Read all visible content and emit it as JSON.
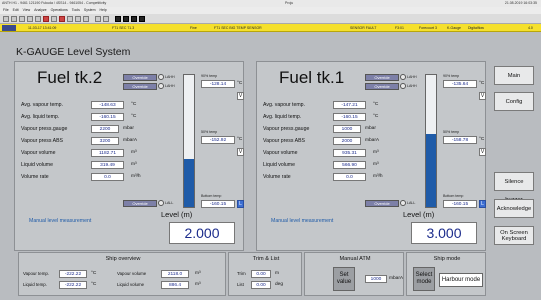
{
  "window": {
    "title": "ANTH H1 - 9461 121190 Fukuda / 4SS14 - 9461054 - Competitivity",
    "center_title": "Proju",
    "right_info": "21.08.2019 16:03:35"
  },
  "menu": [
    "File",
    "Edit",
    "View",
    "Analyze",
    "Operations",
    "Tools",
    "System",
    "Help"
  ],
  "alarm_bar": {
    "items": [
      "11-03-17 13:41:09",
      "FT1 SEC 71.3",
      "Fine",
      "FT1 SEC BIG TEMP SENSOR",
      "SENSOR FAULT",
      "F3:01",
      "Forecourt 3",
      "K-Gauge",
      "Digitalflow",
      "4.0"
    ]
  },
  "page": {
    "title": "K-GAUGE Level System"
  },
  "labels": {
    "avg_vapour": "Avg. vapour temp.",
    "avg_liquid": "Avg. liquid temp.",
    "vap_press_gauge": "Vapour press.gauge",
    "vap_press_abs": "Vapour press ABS",
    "vap_volume": "Vapour volume",
    "liq_volume": "Liquid volume",
    "vol_rate": "Volume rate",
    "override": "Override",
    "lahh": "LAHH",
    "lahi": "LAHH",
    "lall": "LALL",
    "manual": "Manual level measurement",
    "level": "Level (m)",
    "top_temp": "90% temp",
    "mid_temp": "50% temp",
    "bottom_temp": "Bottom temp"
  },
  "tank2": {
    "name": "Fuel tk.2",
    "avg_vapour": "-148.63",
    "avg_vapour_unit": "°C",
    "avg_liquid": "-160.15",
    "avg_liquid_unit": "°C",
    "vap_press_gauge": "2200",
    "vap_press_gauge_unit": "mbar",
    "vap_press_abs": "3200",
    "vap_press_abs_unit": "mbarA",
    "vap_volume": "1182.71",
    "vap_volume_unit": "m³",
    "liq_volume": "319.49",
    "liq_volume_unit": "m³",
    "vol_rate": "0.0",
    "vol_rate_unit": "m³/h",
    "top_temp": "-128.14",
    "top_temp_unit": "°C",
    "top_flag": "V",
    "mid_temp": "-152.92",
    "mid_temp_unit": "°C",
    "mid_flag": "V",
    "bottom_temp": "-160.15",
    "bottom_temp_unit": "°C",
    "bottom_flag": "L",
    "level": "2.000",
    "fill_fraction": 0.36
  },
  "tank1": {
    "name": "Fuel tk.1",
    "avg_vapour": "-147.21",
    "avg_vapour_unit": "°C",
    "avg_liquid": "-160.15",
    "avg_liquid_unit": "°C",
    "vap_press_gauge": "1000",
    "vap_press_gauge_unit": "mbar",
    "vap_press_abs": "2000",
    "vap_press_abs_unit": "mbarA",
    "vap_volume": "935.31",
    "vap_volume_unit": "m³",
    "liq_volume": "566.90",
    "liq_volume_unit": "m³",
    "vol_rate": "0.0",
    "vol_rate_unit": "m³/h",
    "top_temp": "-135.64",
    "top_temp_unit": "°C",
    "top_flag": "V",
    "mid_temp": "-158.78",
    "mid_temp_unit": "°C",
    "mid_flag": "V",
    "bottom_temp": "-160.15",
    "bottom_temp_unit": "°C",
    "bottom_flag": "L",
    "level": "3.000",
    "fill_fraction": 0.55
  },
  "side_buttons": {
    "main": "Main",
    "config": "Config",
    "silence": "Silence buzzer",
    "acknowledge": "Acknowledge",
    "keyboard_1": "On Screen",
    "keyboard_2": "Keyboard"
  },
  "ship_overview": {
    "title": "Ship overview",
    "vapour_temp_lbl": "Vapour temp.",
    "vapour_temp": "-222.22",
    "vapour_temp_unit": "°C",
    "liquid_temp_lbl": "Liquid temp.",
    "liquid_temp": "-222.22",
    "liquid_temp_unit": "°C",
    "vapour_vol_lbl": "Vapour volume",
    "vapour_vol": "2118.0",
    "vapour_vol_unit": "m³",
    "liquid_vol_lbl": "Liquid volume",
    "liquid_vol": "886.4",
    "liquid_vol_unit": "m³"
  },
  "trim_list": {
    "title": "Trim & List",
    "trim_lbl": "Trim",
    "trim": "0.00",
    "trim_unit": "m",
    "list_lbl": "List",
    "list": "0.00",
    "list_unit": "deg"
  },
  "manual_atm": {
    "title": "Manual ATM",
    "set_1": "Set",
    "set_2": "value",
    "value": "1000",
    "unit": "mbarA"
  },
  "ship_mode": {
    "title": "Ship mode",
    "select_1": "Select",
    "select_2": "mode",
    "mode": "Harbour mode"
  }
}
